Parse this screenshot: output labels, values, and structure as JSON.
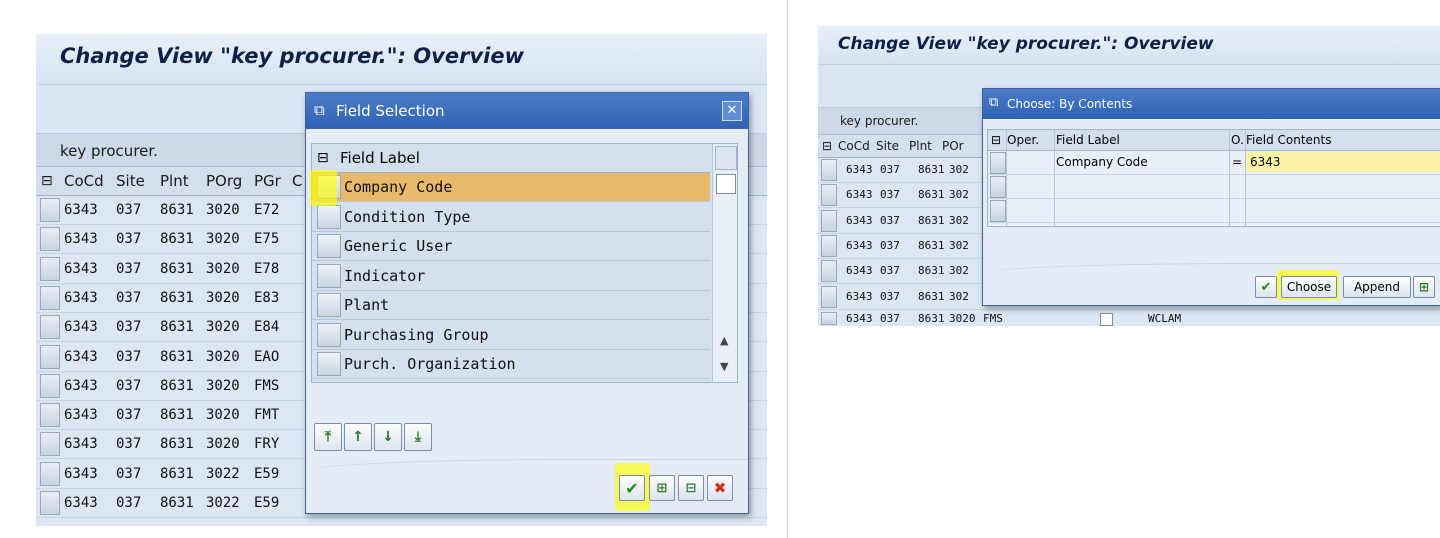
{
  "left": {
    "title": "Change View \"key procurer.\": Overview",
    "table_title": "key procurer.",
    "columns": [
      "CoCd",
      "Site",
      "Plnt",
      "POrg",
      "PGr",
      "C"
    ],
    "rows": [
      [
        "6343",
        "037",
        "8631",
        "3020",
        "E72"
      ],
      [
        "6343",
        "037",
        "8631",
        "3020",
        "E75"
      ],
      [
        "6343",
        "037",
        "8631",
        "3020",
        "E78"
      ],
      [
        "6343",
        "037",
        "8631",
        "3020",
        "E83"
      ],
      [
        "6343",
        "037",
        "8631",
        "3020",
        "E84"
      ],
      [
        "6343",
        "037",
        "8631",
        "3020",
        "EAO"
      ],
      [
        "6343",
        "037",
        "8631",
        "3020",
        "FMS"
      ],
      [
        "6343",
        "037",
        "8631",
        "3020",
        "FMT"
      ],
      [
        "6343",
        "037",
        "8631",
        "3020",
        "FRY"
      ],
      [
        "6343",
        "037",
        "8631",
        "3022",
        "E59"
      ],
      [
        "6343",
        "037",
        "8631",
        "3022",
        "E59"
      ]
    ]
  },
  "field_selection": {
    "title": "Field Selection",
    "header": "Field Label",
    "items": [
      "Company Code",
      "Condition Type",
      "Generic User",
      "Indicator",
      "Plant",
      "Purchasing Group",
      "Purch. Organization"
    ],
    "selected_index": 0,
    "highlight_color": "#e8b96a"
  },
  "right": {
    "title": "Change View \"key procurer.\": Overview",
    "table_title": "key procurer.",
    "columns": [
      "CoCd",
      "Site",
      "Plnt",
      "POr"
    ],
    "rows": [
      [
        "6343",
        "037",
        "8631",
        "302"
      ],
      [
        "6343",
        "037",
        "8631",
        "302"
      ],
      [
        "6343",
        "037",
        "8631",
        "302"
      ],
      [
        "6343",
        "037",
        "8631",
        "302"
      ],
      [
        "6343",
        "037",
        "8631",
        "302"
      ],
      [
        "6343",
        "037",
        "8631",
        "302"
      ]
    ],
    "last_row": [
      "6343",
      "037",
      "8631",
      "3020",
      "FMS",
      "WCLAM"
    ]
  },
  "choose_dialog": {
    "title": "Choose: By Contents",
    "columns": {
      "oper": "Oper.",
      "label": "Field Label",
      "o": "O.",
      "contents": "Field Contents"
    },
    "row": {
      "label": "Company Code",
      "op": "=",
      "value": "6343"
    },
    "buttons": {
      "choose": "Choose",
      "append": "Append"
    }
  }
}
